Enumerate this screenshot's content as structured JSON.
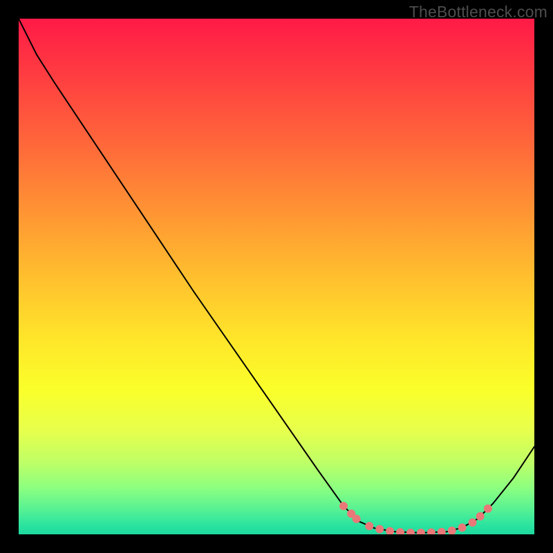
{
  "watermark": "TheBottleneck.com",
  "colors": {
    "marker": "#e97878",
    "curve": "#000000"
  },
  "chart_data": {
    "type": "line",
    "title": "",
    "xlabel": "",
    "ylabel": "",
    "xlim": [
      0,
      100
    ],
    "ylim": [
      0,
      100
    ],
    "grid": false,
    "gradient_stops": [
      {
        "pos": 0,
        "color": "#ff1a47"
      },
      {
        "pos": 12,
        "color": "#ff4040"
      },
      {
        "pos": 25,
        "color": "#ff6a3a"
      },
      {
        "pos": 38,
        "color": "#ff9633"
      },
      {
        "pos": 50,
        "color": "#ffbf2e"
      },
      {
        "pos": 62,
        "color": "#ffe52a"
      },
      {
        "pos": 72,
        "color": "#faff2a"
      },
      {
        "pos": 80,
        "color": "#e6ff4d"
      },
      {
        "pos": 86,
        "color": "#bfff66"
      },
      {
        "pos": 91,
        "color": "#8cff80"
      },
      {
        "pos": 95,
        "color": "#59f293"
      },
      {
        "pos": 98,
        "color": "#2ee59f"
      },
      {
        "pos": 100,
        "color": "#1cd99f"
      }
    ],
    "curve": [
      {
        "x": 0.0,
        "y": 100.0
      },
      {
        "x": 3.5,
        "y": 93.0
      },
      {
        "x": 7.0,
        "y": 87.5
      },
      {
        "x": 10.0,
        "y": 83.0
      },
      {
        "x": 18.0,
        "y": 71.0
      },
      {
        "x": 26.0,
        "y": 59.0
      },
      {
        "x": 34.0,
        "y": 47.0
      },
      {
        "x": 42.0,
        "y": 35.5
      },
      {
        "x": 50.0,
        "y": 24.0
      },
      {
        "x": 58.0,
        "y": 12.5
      },
      {
        "x": 63.0,
        "y": 5.5
      },
      {
        "x": 66.0,
        "y": 2.5
      },
      {
        "x": 69.0,
        "y": 1.2
      },
      {
        "x": 73.0,
        "y": 0.5
      },
      {
        "x": 78.0,
        "y": 0.3
      },
      {
        "x": 83.0,
        "y": 0.5
      },
      {
        "x": 86.0,
        "y": 1.3
      },
      {
        "x": 89.0,
        "y": 3.0
      },
      {
        "x": 92.0,
        "y": 6.0
      },
      {
        "x": 96.0,
        "y": 11.0
      },
      {
        "x": 100.0,
        "y": 17.0
      }
    ],
    "markers": [
      {
        "x": 63.0,
        "y": 5.5
      },
      {
        "x": 64.5,
        "y": 4.0
      },
      {
        "x": 65.5,
        "y": 3.0
      },
      {
        "x": 68.0,
        "y": 1.6
      },
      {
        "x": 70.0,
        "y": 1.0
      },
      {
        "x": 72.0,
        "y": 0.6
      },
      {
        "x": 74.0,
        "y": 0.4
      },
      {
        "x": 76.0,
        "y": 0.3
      },
      {
        "x": 78.0,
        "y": 0.3
      },
      {
        "x": 80.0,
        "y": 0.35
      },
      {
        "x": 82.0,
        "y": 0.45
      },
      {
        "x": 84.0,
        "y": 0.7
      },
      {
        "x": 86.0,
        "y": 1.3
      },
      {
        "x": 88.0,
        "y": 2.3
      },
      {
        "x": 89.5,
        "y": 3.5
      },
      {
        "x": 91.0,
        "y": 5.0
      }
    ],
    "marker_radius": 6
  }
}
